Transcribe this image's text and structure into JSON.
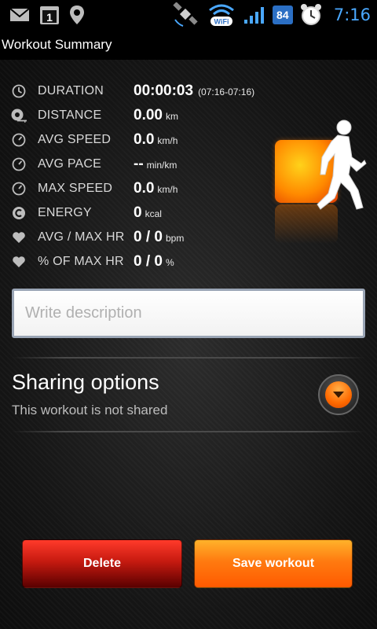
{
  "status_bar": {
    "battery": "84",
    "time": "7:16",
    "colors": {
      "time": "#4aa8ff",
      "battery": "#2b6fc4"
    },
    "icons": [
      "gmail-icon",
      "calendar-icon",
      "location-icon",
      "satellite-icon",
      "wifi-icon",
      "signal-icon",
      "battery-icon",
      "alarm-clock-icon"
    ],
    "calendar_day": "1",
    "wifi_label": "WiFi"
  },
  "title": "Workout Summary",
  "stats": [
    {
      "icon": "clock-icon",
      "label": "DURATION",
      "value": "00:00:03",
      "unit": "",
      "extra": "(07:16-07:16)"
    },
    {
      "icon": "distance-icon",
      "label": "DISTANCE",
      "value": "0.00",
      "unit": "km",
      "extra": ""
    },
    {
      "icon": "speedometer-icon",
      "label": "AVG SPEED",
      "value": "0.0",
      "unit": "km/h",
      "extra": ""
    },
    {
      "icon": "speedometer-icon",
      "label": "AVG PACE",
      "value": "--",
      "unit": "min/km",
      "extra": ""
    },
    {
      "icon": "speedometer-icon",
      "label": "MAX SPEED",
      "value": "0.0",
      "unit": "km/h",
      "extra": ""
    },
    {
      "icon": "energy-icon",
      "label": "ENERGY",
      "value": "0",
      "unit": "kcal",
      "extra": ""
    },
    {
      "icon": "heart-icon",
      "label": "AVG / MAX HR",
      "value": "0 / 0",
      "unit": "bpm",
      "extra": ""
    },
    {
      "icon": "heart-icon",
      "label": "% OF MAX HR",
      "value": "0 / 0",
      "unit": "%",
      "extra": ""
    }
  ],
  "description": {
    "placeholder": "Write description",
    "value": ""
  },
  "sharing": {
    "title": "Sharing options",
    "subtitle": "This workout is not shared"
  },
  "buttons": {
    "delete": "Delete",
    "save": "Save workout"
  },
  "accent_colors": {
    "orange": "#ff7a10",
    "red": "#c61a10"
  }
}
